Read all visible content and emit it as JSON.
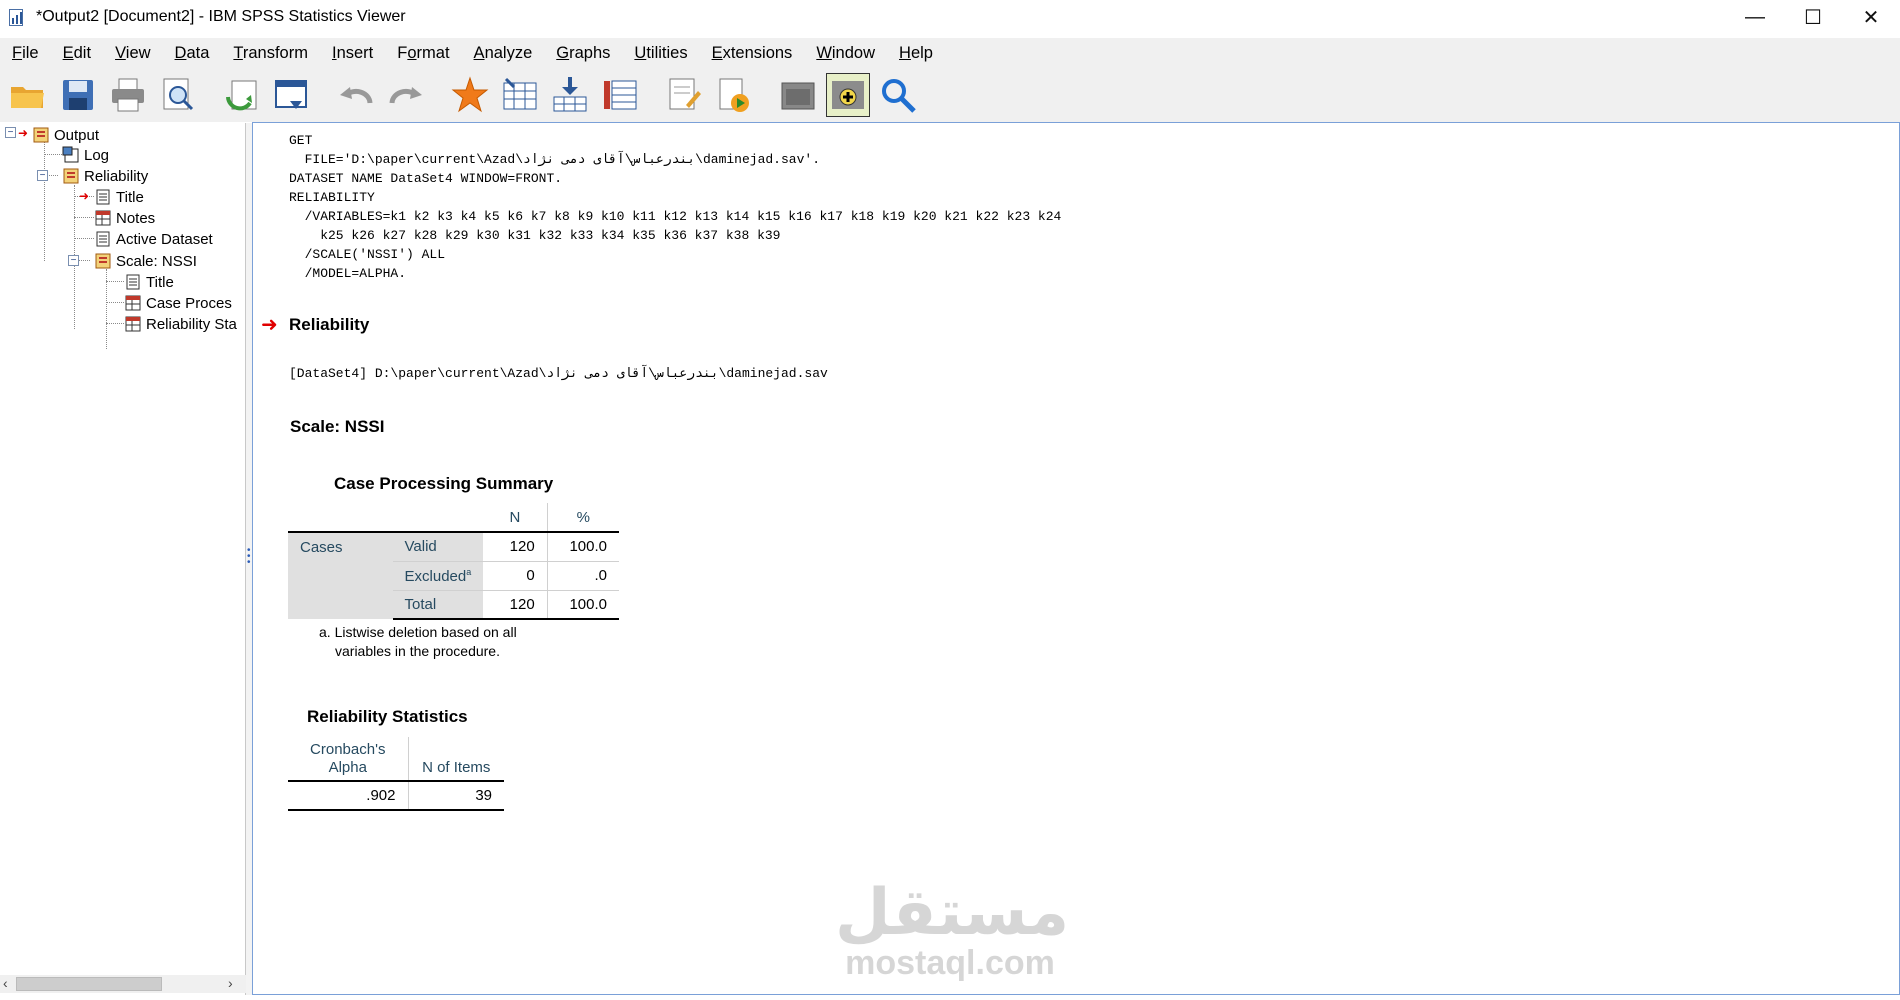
{
  "window": {
    "title": "*Output2 [Document2] - IBM SPSS Statistics Viewer",
    "minimize": "—",
    "maximize": "☐",
    "close": "✕"
  },
  "menu": [
    {
      "key": "F",
      "rest": "ile"
    },
    {
      "key": "E",
      "rest": "dit"
    },
    {
      "key": "V",
      "rest": "iew"
    },
    {
      "key": "D",
      "rest": "ata"
    },
    {
      "key": "T",
      "rest": "ransform"
    },
    {
      "key": "I",
      "rest": "nsert"
    },
    {
      "key": "",
      "pre": "F",
      "key2": "o",
      "rest": "rmat"
    },
    {
      "key": "A",
      "rest": "nalyze"
    },
    {
      "key": "G",
      "rest": "raphs"
    },
    {
      "key": "U",
      "rest": "tilities"
    },
    {
      "key": "E",
      "rest": "xtensions"
    },
    {
      "key": "W",
      "rest": "indow"
    },
    {
      "key": "H",
      "rest": "elp"
    }
  ],
  "toolbar_icons": [
    "open-folder-icon",
    "save-icon",
    "print-icon",
    "print-preview-icon",
    "export-icon",
    "goto-data-icon",
    "undo-icon",
    "redo-icon",
    "goto-case-icon",
    "goto-variable-icon",
    "insert-cases-icon",
    "variables-icon",
    "designate-window-icon",
    "run-script-icon",
    "hide-icon",
    "show-icon",
    "search-icon"
  ],
  "outline": {
    "output": "Output",
    "log": "Log",
    "reliability": "Reliability",
    "title1": "Title",
    "notes": "Notes",
    "active_dataset": "Active Dataset",
    "scale": "Scale: NSSI",
    "title2": "Title",
    "case_proc": "Case Proces",
    "rel_stats": "Reliability Sta"
  },
  "syntax": [
    "GET",
    "  FILE='D:\\paper\\current\\Azad\\بندرعباس\\آقای دمی نژاد\\daminejad.sav'.",
    "DATASET NAME DataSet4 WINDOW=FRONT.",
    "RELIABILITY",
    "  /VARIABLES=k1 k2 k3 k4 k5 k6 k7 k8 k9 k10 k11 k12 k13 k14 k15 k16 k17 k18 k19 k20 k21 k22 k23 k24",
    "    k25 k26 k27 k28 k29 k30 k31 k32 k33 k34 k35 k36 k37 k38 k39",
    "  /SCALE('NSSI') ALL",
    "  /MODEL=ALPHA."
  ],
  "reliability_heading": "Reliability",
  "dataset_line": "[DataSet4] D:\\paper\\current\\Azad\\بندرعباس\\آقای دمی نژاد\\daminejad.sav",
  "scale_title": "Scale: NSSI",
  "case_summary": {
    "title": "Case Processing Summary",
    "col_n": "N",
    "col_pct": "%",
    "row_group": "Cases",
    "rows": [
      {
        "label": "Valid",
        "sup": "",
        "n": "120",
        "pct": "100.0"
      },
      {
        "label": "Excluded",
        "sup": "a",
        "n": "0",
        "pct": ".0"
      },
      {
        "label": "Total",
        "sup": "",
        "n": "120",
        "pct": "100.0"
      }
    ],
    "footnote_1": "a. Listwise deletion based on all",
    "footnote_2": "variables in the procedure."
  },
  "reliability_stats": {
    "title": "Reliability Statistics",
    "col_alpha_1": "Cronbach's",
    "col_alpha_2": "Alpha",
    "col_items": "N of Items",
    "alpha": ".902",
    "items": "39"
  },
  "watermark": {
    "arabic": "مستقل",
    "latin": "mostaql.com"
  }
}
